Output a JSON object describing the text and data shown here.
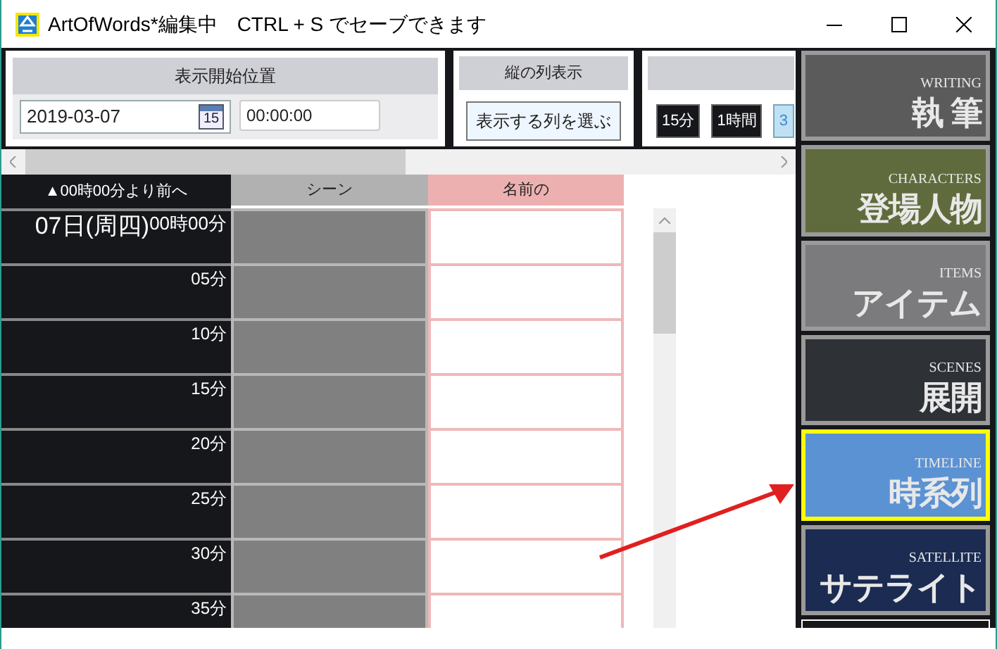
{
  "window": {
    "title": "ArtOfWords*編集中　CTRL + S でセーブできます"
  },
  "start_position": {
    "title": "表示開始位置",
    "date": "2019-03-07",
    "calendar_day": "15",
    "time": "00:00:00"
  },
  "column_display": {
    "title": "縦の列表示",
    "button": "表示する列を選ぶ"
  },
  "interval": {
    "buttons": [
      {
        "label": "15分",
        "selected": false
      },
      {
        "label": "1時間",
        "selected": false
      },
      {
        "label": "3",
        "selected": true
      }
    ]
  },
  "table": {
    "columns": [
      "▲00時00分より前へ",
      "シーン",
      "名前の"
    ],
    "rows": [
      {
        "date": "07日(周四)",
        "time": "00時00分"
      },
      {
        "time": "05分"
      },
      {
        "time": "10分"
      },
      {
        "time": "15分"
      },
      {
        "time": "20分"
      },
      {
        "time": "25分"
      },
      {
        "time": "30分"
      },
      {
        "time": "35分"
      }
    ]
  },
  "sidebar": {
    "items": [
      {
        "en": "WRITING",
        "label": "執 筆",
        "color": "#5b5b5b",
        "selected": false
      },
      {
        "en": "CHARACTERS",
        "label": "登場人物",
        "color": "#5f6b3c",
        "selected": false
      },
      {
        "en": "ITEMS",
        "label": "アイテム",
        "color": "#7b7b7d",
        "selected": false
      },
      {
        "en": "SCENES",
        "label": "展開",
        "color": "#2e3136",
        "selected": false
      },
      {
        "en": "TIMELINE",
        "label": "時系列",
        "color": "#5b92d4",
        "selected": true
      },
      {
        "en": "SATELLITE",
        "label": "サテライト",
        "color": "#1b2b52",
        "selected": false
      }
    ]
  }
}
